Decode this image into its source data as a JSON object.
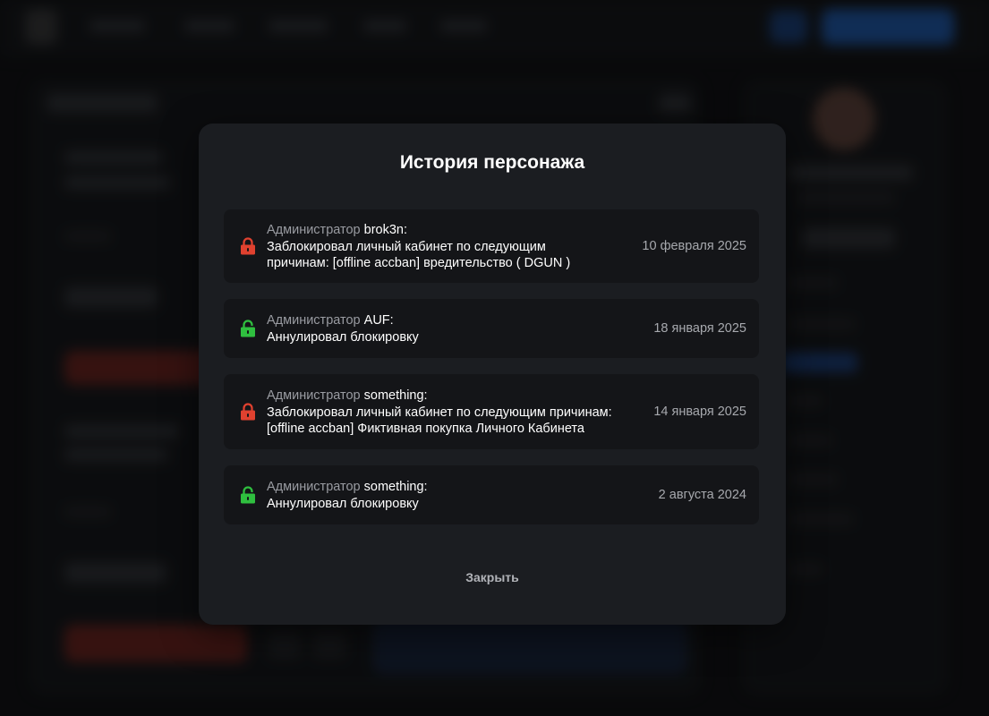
{
  "modal": {
    "title": "История персонажа",
    "close_label": "Закрыть",
    "entries": [
      {
        "status": "locked",
        "role": "Администратор",
        "admin": "brok3n:",
        "action_line1": "Заблокировал личный кабинет по следующим",
        "action_line2": "причинам: [offline accban] вредительство ( DGUN )",
        "date": "10 февраля 2025"
      },
      {
        "status": "unlocked",
        "role": "Администратор",
        "admin": "AUF:",
        "action_line1": "Аннулировал блокировку",
        "date": "18 января 2025"
      },
      {
        "status": "locked",
        "role": "Администратор",
        "admin": "something:",
        "action_line1": "Заблокировал личный кабинет по следующим причинам:",
        "action_line2": "[offline accban] Фиктивная покупка Личного Кабинета",
        "date": "14 января 2025"
      },
      {
        "status": "unlocked",
        "role": "Администратор",
        "admin": "something:",
        "action_line1": "Аннулировал блокировку",
        "date": "2 августа 2024"
      }
    ]
  },
  "colors": {
    "locked": "#e0412f",
    "unlocked": "#2fbf3f",
    "modal_bg": "#1b1d21",
    "entry_bg": "#141518"
  },
  "icons": {
    "locked": "lock-closed-icon",
    "unlocked": "lock-open-icon"
  }
}
